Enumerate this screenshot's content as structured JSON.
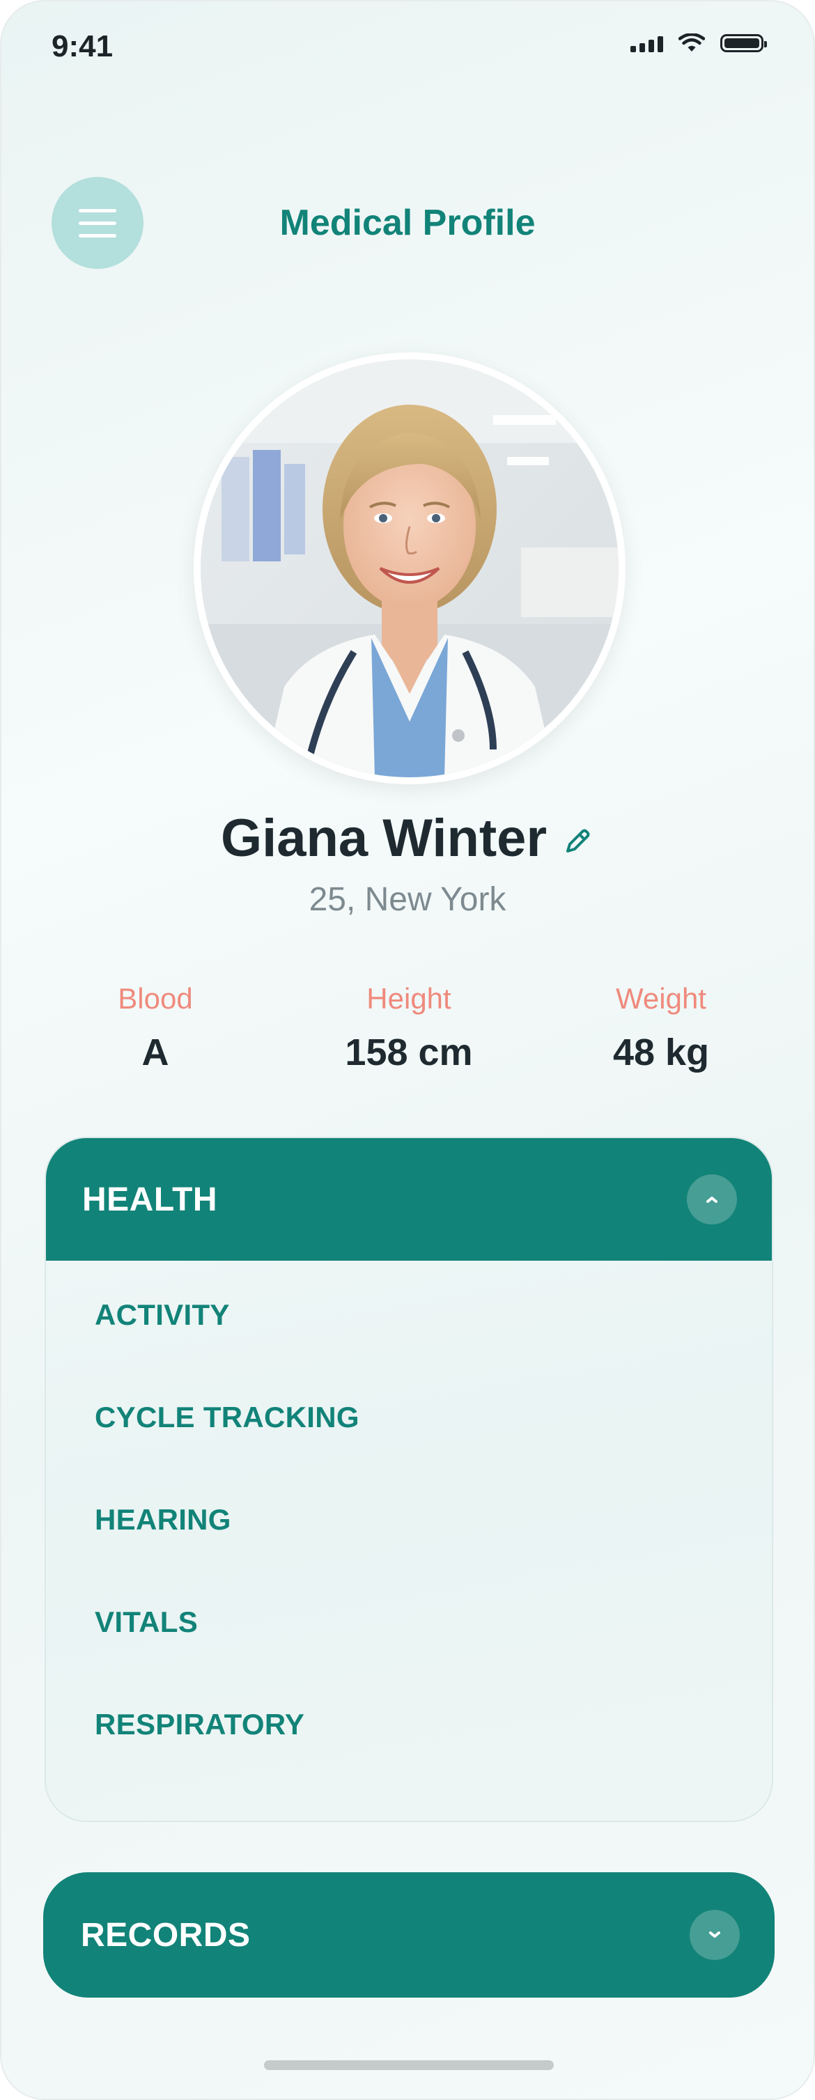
{
  "status_bar": {
    "time": "9:41",
    "icons": [
      "signal-icon",
      "wifi-icon",
      "battery-icon"
    ]
  },
  "header": {
    "title": "Medical Profile",
    "menu_icon": "hamburger-menu-icon"
  },
  "profile": {
    "name": "Giana Winter",
    "subtitle": "25, New York",
    "edit_icon": "pencil-icon"
  },
  "stats": [
    {
      "label": "Blood",
      "value": "A"
    },
    {
      "label": "Height",
      "value": "158 cm"
    },
    {
      "label": "Weight",
      "value": "48 kg"
    }
  ],
  "health": {
    "title": "HEALTH",
    "expanded": true,
    "toggle_icon": "chevron-up-icon",
    "items": [
      "ACTIVITY",
      "CYCLE TRACKING",
      "HEARING",
      "VITALS",
      "RESPIRATORY"
    ]
  },
  "records": {
    "title": "RECORDS",
    "expanded": false,
    "toggle_icon": "chevron-down-icon"
  },
  "colors": {
    "primary": "#128378",
    "accent_label": "#ef8a7d",
    "menu_button": "#b3dfdc",
    "text_dark": "#1e2a30",
    "text_muted": "#7d8a90"
  }
}
